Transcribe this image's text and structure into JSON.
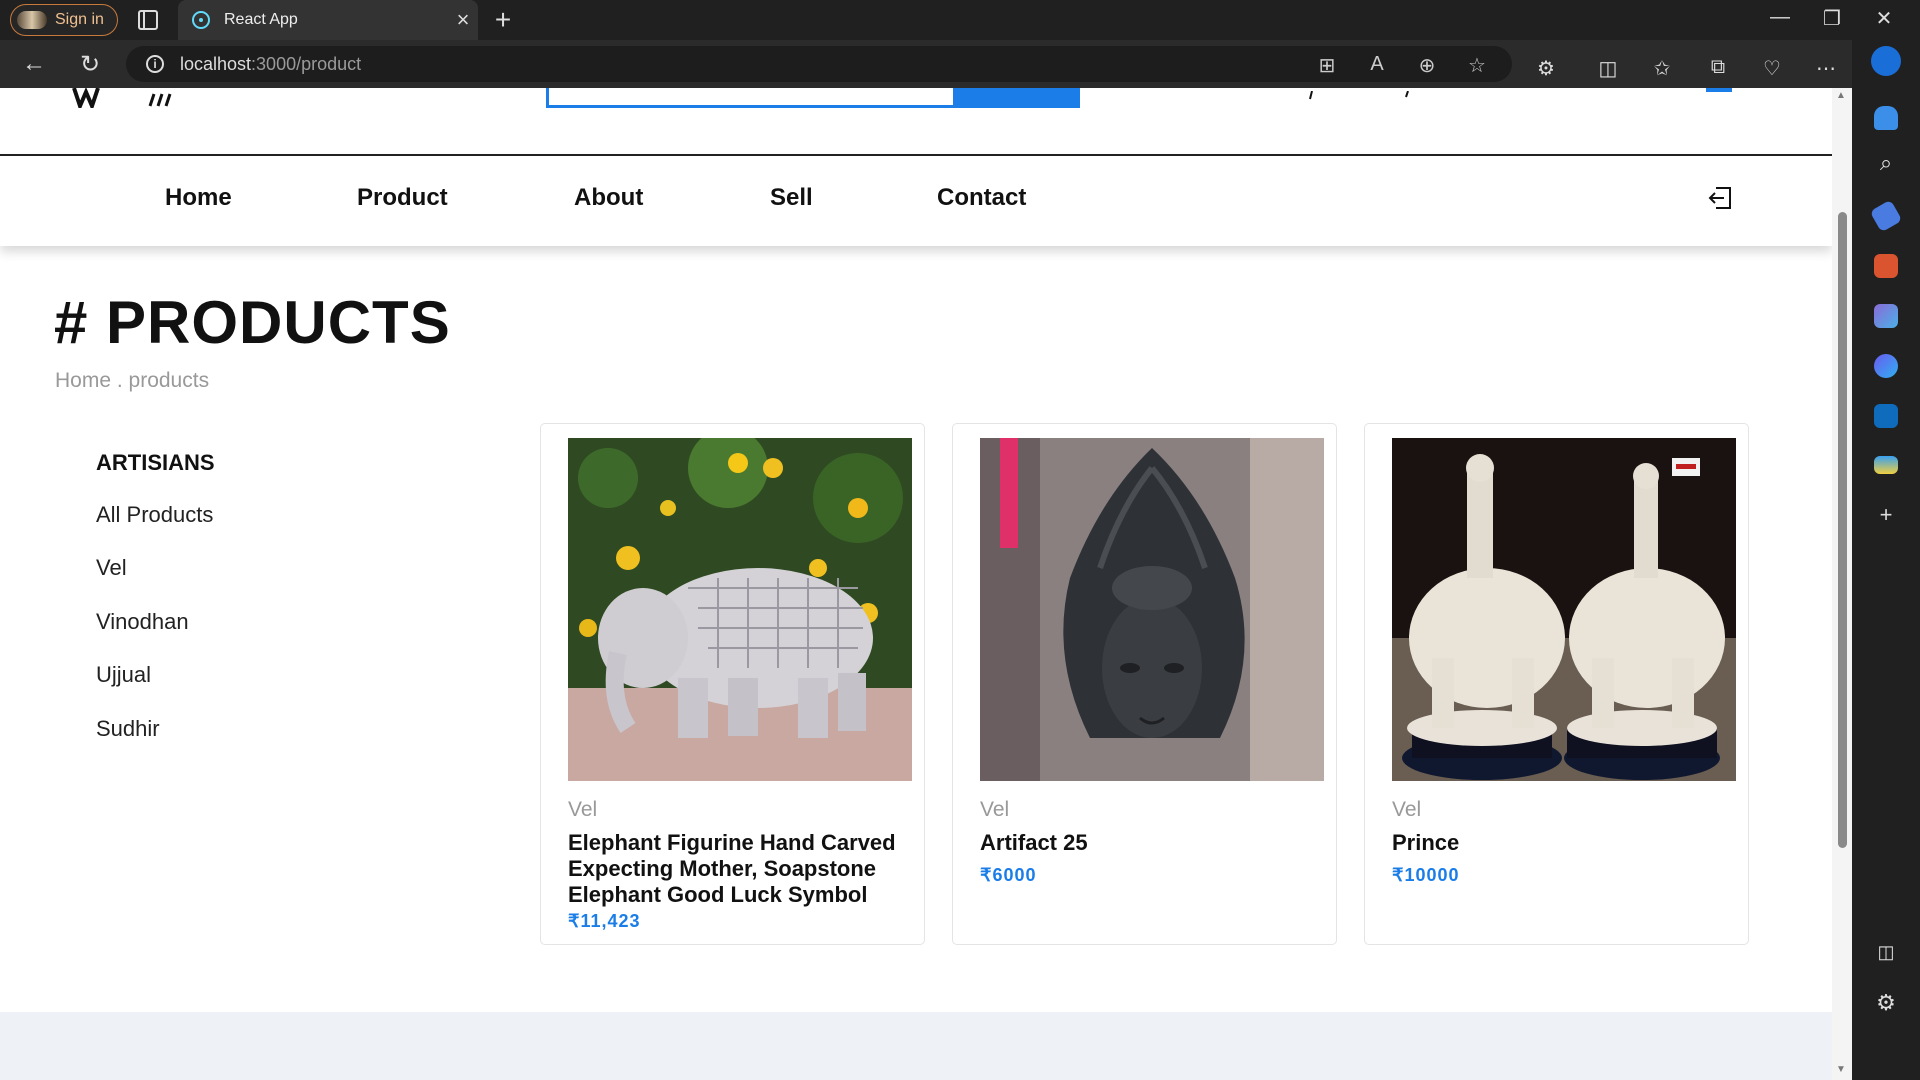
{
  "browser": {
    "profile_label": "Sign in",
    "tab_title": "React App",
    "url_host": "localhost",
    "url_path": ":3000/product"
  },
  "nav": {
    "items": [
      "Home",
      "Product",
      "About",
      "Sell",
      "Contact"
    ]
  },
  "page": {
    "title": "# PRODUCTS",
    "breadcrumb": "Home . products"
  },
  "filters": {
    "heading": "ARTISIANS",
    "items": [
      "All Products",
      "Vel",
      "Vinodhan",
      "Ujjual",
      "Sudhir"
    ]
  },
  "products": [
    {
      "artisan": "Vel",
      "name": "Elephant Figurine Hand Carved Expecting Mother, Soapstone Elephant Good Luck Symbol",
      "price": "₹11,423"
    },
    {
      "artisan": "Vel",
      "name": "Artifact 25",
      "price": "₹6000"
    },
    {
      "artisan": "Vel",
      "name": "Prince",
      "price": "₹10000"
    }
  ],
  "colors": {
    "accent": "#1a7de8",
    "footer": "#eef1f6"
  }
}
